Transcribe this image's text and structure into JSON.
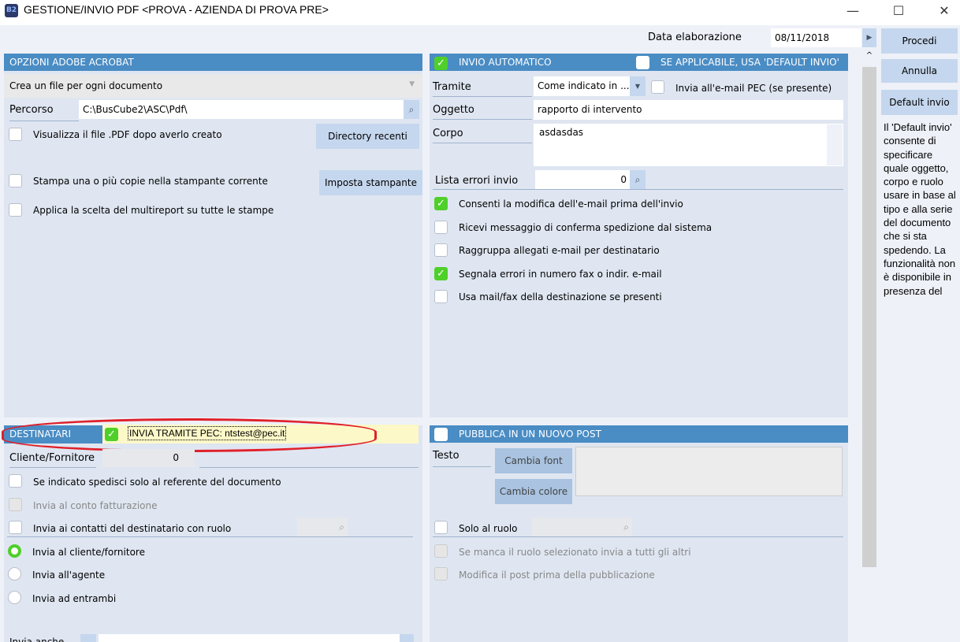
{
  "window": {
    "title": "GESTIONE/INVIO PDF <PROVA - AZIENDA DI PROVA PRE>",
    "icon": "B2",
    "minimize": "—",
    "maximize": "☐",
    "close": "✕"
  },
  "header": {
    "date_label": "Data elaborazione",
    "date_value": "08/11/2018"
  },
  "actions": {
    "procedi": "Procedi",
    "annulla": "Annulla",
    "default_invio": "Default invio",
    "note": "Il 'Default invio' consente di specificare quale oggetto, corpo e ruolo usare in base al tipo e alla serie del documento che si sta spedendo. La funzionalità non è disponibile in presenza del"
  },
  "acrobat": {
    "title": "OPZIONI ADOBE ACROBAT",
    "mode": "Crea un file per ogni documento",
    "percorso_label": "Percorso",
    "percorso_value": "C:\\BusCube2\\ASC\\Pdf\\",
    "visualizza": "Visualizza il file .PDF dopo averlo creato",
    "dir_recenti": "Directory recenti",
    "stampa": "Stampa una o più copie nella stampante corrente",
    "imposta_stampante": "Imposta stampante",
    "multireport": "Applica la scelta del multireport su tutte le stampe"
  },
  "invio": {
    "title": "INVIO AUTOMATICO",
    "default_label": "SE APPLICABILE, USA 'DEFAULT INVIO'",
    "tramite_label": "Tramite",
    "tramite_value": "Come indicato in ...",
    "pec_label": "Invia all'e-mail PEC (se presente)",
    "oggetto_label": "Oggetto",
    "oggetto_value": "rapporto di intervento",
    "corpo_label": "Corpo",
    "corpo_value": "asdasdas",
    "lista_label": "Lista errori invio",
    "lista_value": "0",
    "options": [
      {
        "label": "Consenti la modifica dell'e-mail prima dell'invio",
        "checked": true
      },
      {
        "label": "Ricevi messaggio di conferma spedizione dal sistema",
        "checked": false
      },
      {
        "label": "Raggruppa allegati e-mail per destinatario",
        "checked": false
      },
      {
        "label": "Segnala errori in numero fax o indir. e-mail",
        "checked": true
      },
      {
        "label": "Usa mail/fax della destinazione se presenti",
        "checked": false
      }
    ]
  },
  "destinatari": {
    "title": "DESTINATARI",
    "pec_text": "INVIA TRAMITE PEC: ntstest@pec.it",
    "cliente_label": "Cliente/Fornitore",
    "cliente_value": "0",
    "referente": "Se indicato spedisci solo al referente del documento",
    "conto": "Invia al conto fatturazione",
    "contatti": "Invia ai contatti del destinatario con ruolo",
    "radios": [
      "Invia al cliente/fornitore",
      "Invia all'agente",
      "Invia ad entrambi"
    ],
    "bottom_label": "Invia anche"
  },
  "post": {
    "title": "PUBBLICA IN UN NUOVO POST",
    "testo_label": "Testo",
    "cambia_font": "Cambia font",
    "cambia_colore": "Cambia colore",
    "solo_ruolo": "Solo al ruolo",
    "manca_ruolo": "Se manca il ruolo selezionato invia a tutti gli altri",
    "modifica_post": "Modifica il post prima della pubblicazione"
  }
}
